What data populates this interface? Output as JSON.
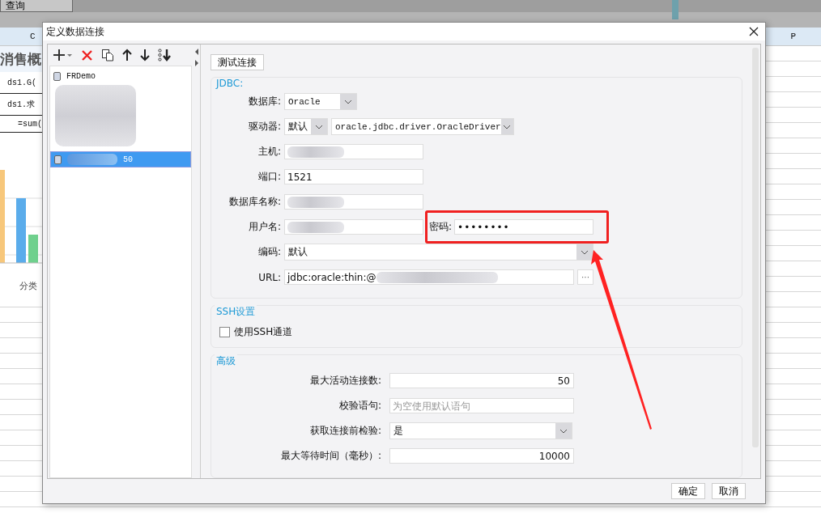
{
  "app": {
    "query_button": "查询",
    "columns": [
      "C",
      "P"
    ],
    "title_cell": "消售概",
    "cells": [
      "ds1.G(",
      "ds1.求",
      "=sum("
    ],
    "chart_label": "分类"
  },
  "dialog": {
    "title": "定义数据连接",
    "connections": [
      {
        "label": "FRDemo",
        "selected": false,
        "redacted": false
      },
      {
        "label": "50",
        "selected": true,
        "redacted": true
      }
    ],
    "test_button": "测试连接",
    "jdbc": {
      "title": "JDBC:",
      "rows": [
        {
          "kind": "select",
          "label": "数据库:",
          "value": "Oracle"
        },
        {
          "kind": "driver",
          "label": "驱动器:",
          "mode": "默认",
          "value": "oracle.jdbc.driver.OracleDriver"
        },
        {
          "kind": "text",
          "label": "主机:",
          "redacted": true
        },
        {
          "kind": "text",
          "label": "端口:",
          "value": "1521",
          "redacted": false
        },
        {
          "kind": "text",
          "label": "数据库名称:",
          "redacted": true
        },
        {
          "kind": "pair",
          "label": "用户名:",
          "redacted": true,
          "second": {
            "label": "密码:",
            "value": "••••••••",
            "highlighted": true
          }
        },
        {
          "kind": "wide_select",
          "label": "编码:",
          "value": "默认"
        },
        {
          "kind": "url",
          "label": "URL:",
          "value": "jdbc:oracle:thin:@",
          "redacted": true,
          "button": "···"
        }
      ]
    },
    "ssh": {
      "title": "SSH设置",
      "checkbox": {
        "label": "使用SSH通道",
        "checked": false
      }
    },
    "advanced": {
      "title": "高级",
      "rows": [
        {
          "kind": "number",
          "label": "最大活动连接数:",
          "value": "50"
        },
        {
          "kind": "text",
          "label": "校验语句:",
          "placeholder": "为空使用默认语句"
        },
        {
          "kind": "select",
          "label": "获取连接前检验:",
          "value": "是"
        },
        {
          "kind": "number",
          "label": "最大等待时间（毫秒）:",
          "value": "10000"
        }
      ]
    },
    "buttons": [
      "确定",
      "取消"
    ]
  }
}
